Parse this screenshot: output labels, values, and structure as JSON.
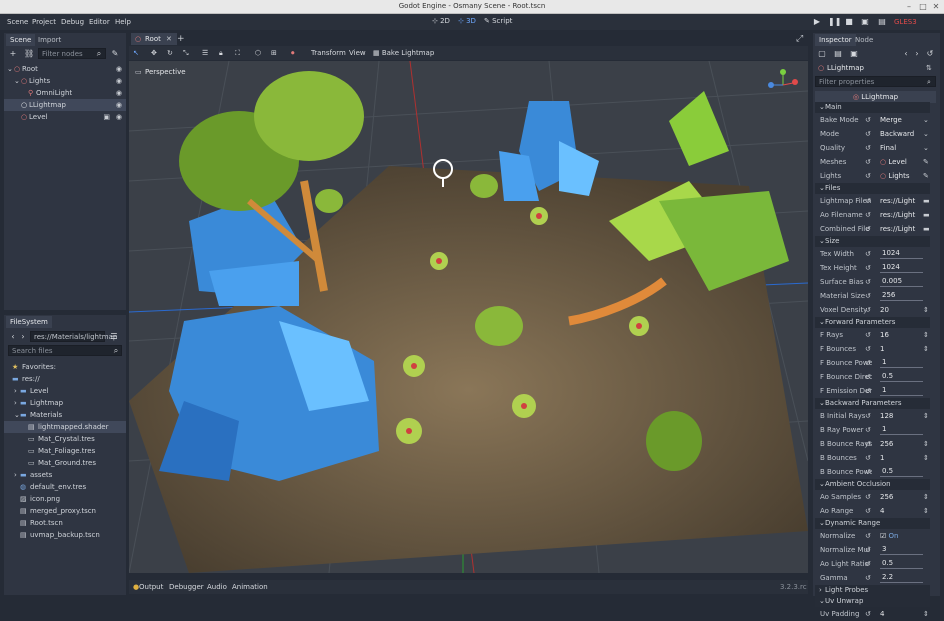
{
  "window": {
    "title": "Godot Engine - Osmany Scene - Root.tscn"
  },
  "menu": {
    "scene": "Scene",
    "project": "Project",
    "debug": "Debug",
    "editor": "Editor",
    "help": "Help"
  },
  "workspaces": {
    "w2d": "2D",
    "w3d": "3D",
    "script": "Script"
  },
  "renderer": "GLES3",
  "scene_dock": {
    "tab_scene": "Scene",
    "tab_import": "Import",
    "filter_placeholder": "Filter nodes",
    "tree": [
      {
        "label": "Root",
        "depth": 0
      },
      {
        "label": "Lights",
        "depth": 1
      },
      {
        "label": "OmniLight",
        "depth": 2
      },
      {
        "label": "LLightmap",
        "depth": 1
      },
      {
        "label": "Level",
        "depth": 1
      }
    ]
  },
  "filesystem": {
    "tab": "FileSystem",
    "path": "res://Materials/lightmap",
    "search_placeholder": "Search files",
    "items": [
      {
        "label": "Favorites:",
        "depth": 0,
        "icon": "star"
      },
      {
        "label": "res://",
        "depth": 0,
        "icon": "folder"
      },
      {
        "label": "Level",
        "depth": 1,
        "icon": "folder"
      },
      {
        "label": "Lightmap",
        "depth": 1,
        "icon": "folder"
      },
      {
        "label": "Materials",
        "depth": 1,
        "icon": "folder"
      },
      {
        "label": "lightmapped.shader",
        "depth": 2,
        "icon": "file"
      },
      {
        "label": "Mat_Crystal.tres",
        "depth": 2,
        "icon": "res"
      },
      {
        "label": "Mat_Foliage.tres",
        "depth": 2,
        "icon": "res"
      },
      {
        "label": "Mat_Ground.tres",
        "depth": 2,
        "icon": "res"
      },
      {
        "label": "assets",
        "depth": 1,
        "icon": "folder"
      },
      {
        "label": "default_env.tres",
        "depth": 1,
        "icon": "globe"
      },
      {
        "label": "icon.png",
        "depth": 1,
        "icon": "image"
      },
      {
        "label": "merged_proxy.tscn",
        "depth": 1,
        "icon": "scene"
      },
      {
        "label": "Root.tscn",
        "depth": 1,
        "icon": "scene"
      },
      {
        "label": "uvmap_backup.tscn",
        "depth": 1,
        "icon": "scene"
      }
    ]
  },
  "viewport": {
    "tab": "Root",
    "perspective": "Perspective",
    "transform": "Transform",
    "view": "View",
    "bake": "Bake Lightmap"
  },
  "bottom": {
    "output": "Output",
    "debugger": "Debugger",
    "audio": "Audio",
    "animation": "Animation",
    "version": "3.2.3.rc"
  },
  "inspector": {
    "tab_inspector": "Inspector",
    "tab_node": "Node",
    "node_name": "LLightmap",
    "filter_placeholder": "Filter properties",
    "node_header": "LLightmap",
    "sections": [
      {
        "title": "Main",
        "rows": [
          {
            "k": "Bake Mode",
            "v": "Merge",
            "type": "dd"
          },
          {
            "k": "Mode",
            "v": "Backward",
            "type": "dd"
          },
          {
            "k": "Quality",
            "v": "Final",
            "type": "dd"
          },
          {
            "k": "Meshes",
            "v": "Level",
            "type": "node"
          },
          {
            "k": "Lights",
            "v": "Lights",
            "type": "node"
          }
        ]
      },
      {
        "title": "Files",
        "rows": [
          {
            "k": "Lightmap Filen",
            "v": "res://Light",
            "type": "file"
          },
          {
            "k": "Ao Filename",
            "v": "res://Light",
            "type": "file"
          },
          {
            "k": "Combined File",
            "v": "res://Light",
            "type": "file"
          }
        ]
      },
      {
        "title": "Size",
        "rows": [
          {
            "k": "Tex Width",
            "v": "1024",
            "type": "num"
          },
          {
            "k": "Tex Height",
            "v": "1024",
            "type": "num"
          },
          {
            "k": "Surface Bias",
            "v": "0.005",
            "type": "num"
          },
          {
            "k": "Material Size",
            "v": "256",
            "type": "num"
          },
          {
            "k": "Voxel Density",
            "v": "20",
            "type": "spin"
          }
        ]
      },
      {
        "title": "Forward Parameters",
        "rows": [
          {
            "k": "F Rays",
            "v": "16",
            "type": "spin"
          },
          {
            "k": "F Bounces",
            "v": "1",
            "type": "spin"
          },
          {
            "k": "F Bounce Power",
            "v": "1",
            "type": "num"
          },
          {
            "k": "F Bounce Directio",
            "v": "0.5",
            "type": "num"
          },
          {
            "k": "F Emission Densit",
            "v": "1",
            "type": "num"
          }
        ]
      },
      {
        "title": "Backward Parameters",
        "rows": [
          {
            "k": "B Initial Rays",
            "v": "128",
            "type": "spin"
          },
          {
            "k": "B Ray Power",
            "v": "1",
            "type": "num"
          },
          {
            "k": "B Bounce Rays",
            "v": "256",
            "type": "spin"
          },
          {
            "k": "B Bounces",
            "v": "1",
            "type": "spin"
          },
          {
            "k": "B Bounce Power",
            "v": "0.5",
            "type": "num"
          }
        ]
      },
      {
        "title": "Ambient Occlusion",
        "rows": [
          {
            "k": "Ao Samples",
            "v": "256",
            "type": "spin"
          },
          {
            "k": "Ao Range",
            "v": "4",
            "type": "spin"
          }
        ]
      },
      {
        "title": "Dynamic Range",
        "rows": [
          {
            "k": "Normalize",
            "v": "On",
            "type": "check"
          },
          {
            "k": "Normalize Mul",
            "v": "3",
            "type": "num"
          },
          {
            "k": "Ao Light Ratio",
            "v": "0.5",
            "type": "num"
          },
          {
            "k": "Gamma",
            "v": "2.2",
            "type": "num"
          }
        ]
      },
      {
        "title": "Light Probes",
        "rows": []
      },
      {
        "title": "Uv Unwrap",
        "rows": [
          {
            "k": "Uv Padding",
            "v": "4",
            "type": "spin"
          }
        ]
      }
    ]
  }
}
